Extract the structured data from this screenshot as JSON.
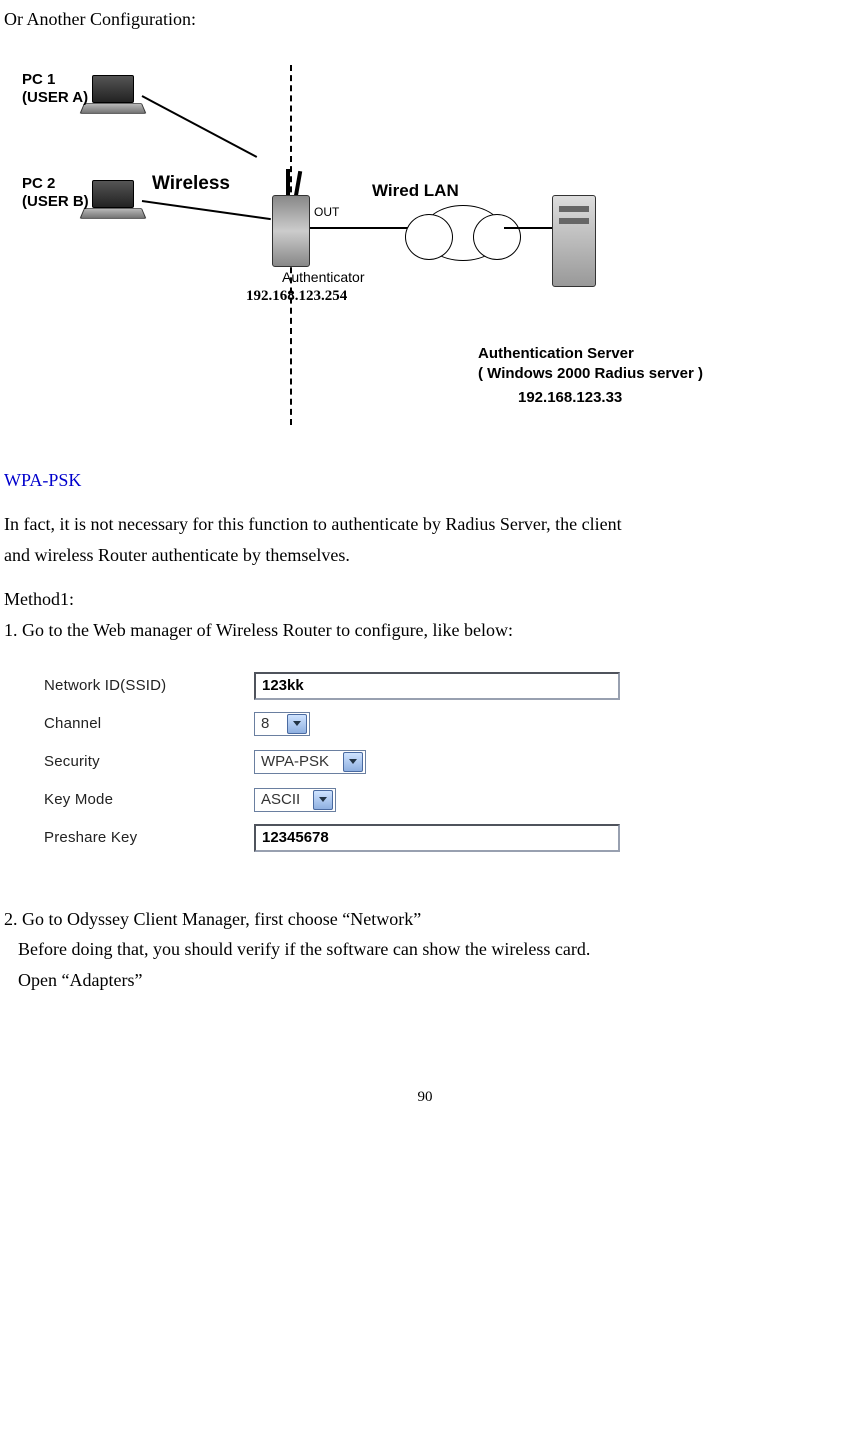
{
  "intro_line": "Or Another Configuration:",
  "diagram": {
    "pc1": "PC 1",
    "user_a": "(USER A)",
    "pc2": "PC 2",
    "user_b": "(USER B)",
    "wireless": "Wireless",
    "wired_lan": "Wired  LAN",
    "out": "OUT",
    "authenticator": "Authenticator",
    "auth_ip": "192.168.123.254",
    "server_line1": "Authentication Server",
    "server_line2": "( Windows 2000 Radius server )",
    "server_ip": "192.168.123.33"
  },
  "wpa_heading": "WPA-PSK",
  "wpa_desc_line1": "In fact, it is not necessary for this function to authenticate by Radius Server, the client",
  "wpa_desc_line2": "and wireless Router authenticate by themselves.",
  "method_heading": "Method1:",
  "step1": "1. Go to the Web manager of Wireless Router to configure, like below:",
  "form": {
    "ssid_label": "Network ID(SSID)",
    "ssid_value": "123kk",
    "channel_label": "Channel",
    "channel_value": "8",
    "security_label": "Security",
    "security_value": "WPA-PSK",
    "keymode_label": "Key Mode",
    "keymode_value": "ASCII",
    "psk_label": "Preshare Key",
    "psk_value": "12345678"
  },
  "step2_line1": "2. Go to Odyssey Client Manager, first choose “Network”",
  "step2_line2": "Before doing that, you should verify if the software can show the wireless card.",
  "step2_line3": "Open “Adapters”",
  "page_number": "90"
}
